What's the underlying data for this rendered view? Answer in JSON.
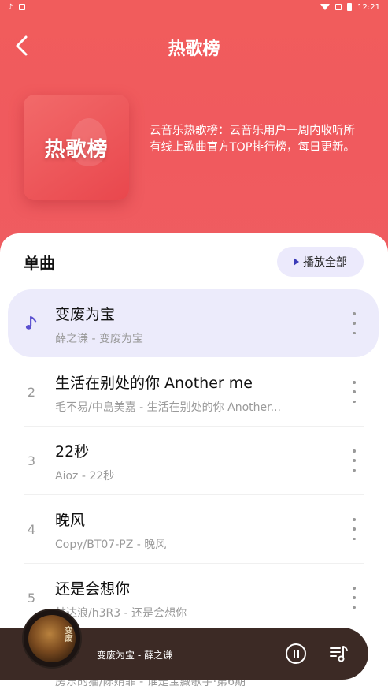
{
  "status_bar": {
    "time": "12:21"
  },
  "header": {
    "title": "热歌榜",
    "cover_text": "热歌榜",
    "description": "云音乐热歌榜：云音乐用户一周内收听所有线上歌曲官方TOP排行榜，每日更新。"
  },
  "panel": {
    "section_title": "单曲",
    "play_all_label": "播放全部"
  },
  "songs": [
    {
      "rank": "",
      "title": "变废为宝",
      "subtitle": "薛之谦 - 变废为宝",
      "playing": true
    },
    {
      "rank": "2",
      "title": "生活在别处的你 Another me",
      "subtitle": "毛不易/中島美嘉 - 生活在别处的你 Another...",
      "playing": false
    },
    {
      "rank": "3",
      "title": "22秒",
      "subtitle": "Aioz - 22秒",
      "playing": false
    },
    {
      "rank": "4",
      "title": "晚风",
      "subtitle": "Copy/BT07-PZ - 晚风",
      "playing": false
    },
    {
      "rank": "5",
      "title": "还是会想你",
      "subtitle": "林达浪/h3R3 - 还是会想你",
      "playing": false
    }
  ],
  "partial_row_subtitle": "房东的猫/陈婧霏 - 谁是宝藏歌手·第6期",
  "player": {
    "track": "变废为宝 - 薛之谦",
    "art_label": "变废"
  },
  "colors": {
    "header_red": "#f05a5e",
    "accent_purple": "#5a4fcf",
    "active_row_bg": "#ecebfb",
    "player_bg": "#3c2a25"
  }
}
